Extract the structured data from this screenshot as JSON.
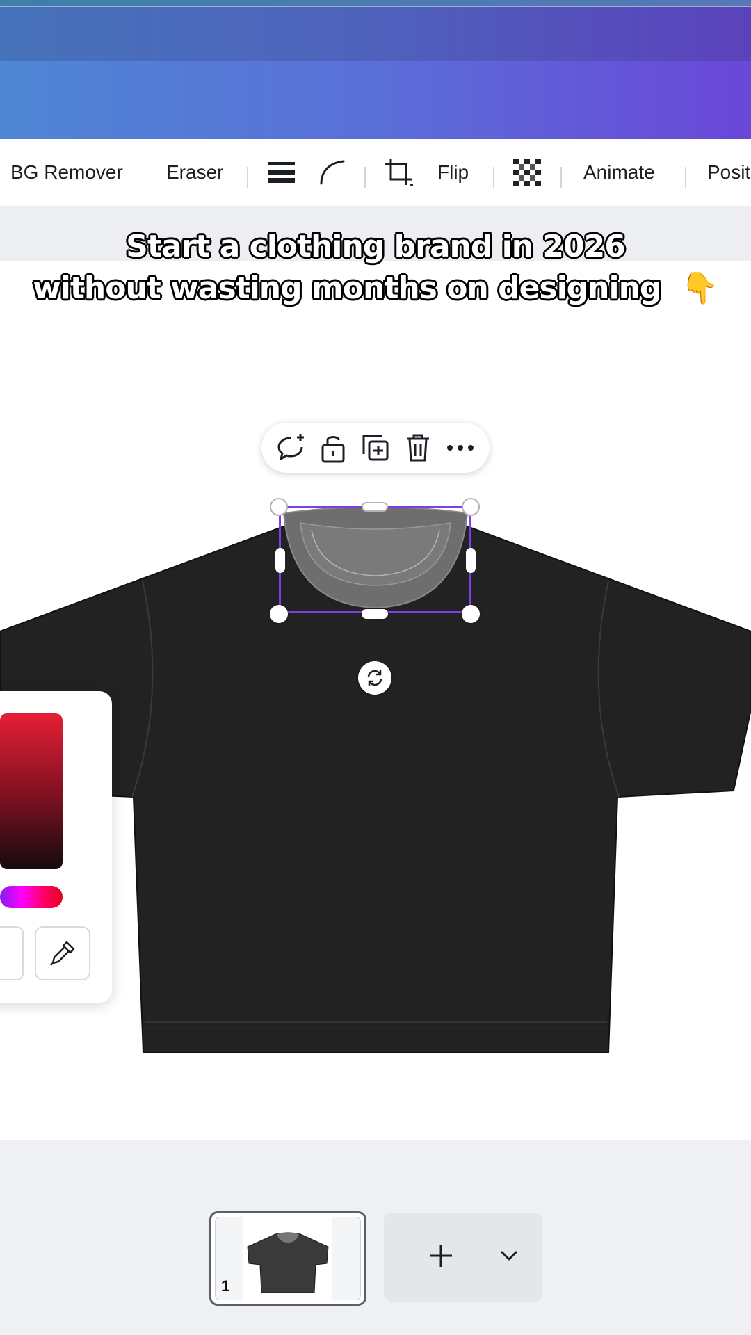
{
  "toolbar": {
    "bg_remover": "BG Remover",
    "eraser": "Eraser",
    "flip": "Flip",
    "animate": "Animate",
    "position": "Posit"
  },
  "caption": {
    "line1": "Start a clothing brand in 2026",
    "line2": "without wasting months on designing",
    "emoji": "👇"
  },
  "float_bar": {
    "icons": [
      "comment-add-icon",
      "unlock-icon",
      "duplicate-icon",
      "delete-icon",
      "more-icon"
    ]
  },
  "pages": {
    "thumb_number": "1"
  },
  "colors": {
    "selection": "#7b3fe4",
    "shirt": "#222222",
    "header_start": "#4f86d4",
    "header_end": "#6a47d8"
  }
}
